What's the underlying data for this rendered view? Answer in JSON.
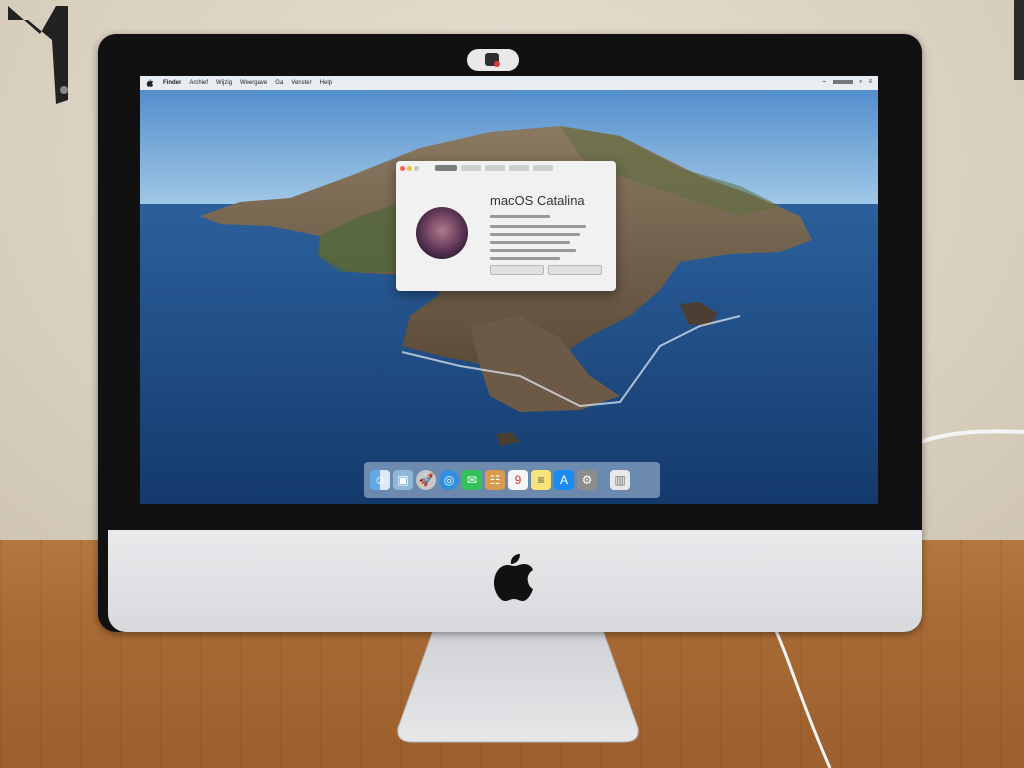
{
  "menubar": {
    "items": [
      "Finder",
      "Archief",
      "Wijzig",
      "Weergave",
      "Ga",
      "Venster",
      "Help"
    ]
  },
  "about_window": {
    "title": "macOS Catalina"
  },
  "dock": {
    "icons": [
      "finder-icon",
      "preview-icon",
      "launchpad-icon",
      "safari-icon",
      "messages-icon",
      "contacts-icon",
      "calendar-icon",
      "notes-icon",
      "app-store-icon",
      "system-preferences-icon",
      "trash-icon"
    ]
  },
  "colors": {
    "sky": "#7fb2e0",
    "sea": "#1b4a82",
    "menubar": "#f5f5f5",
    "bezel": "#111111",
    "chin": "#e1e3e5"
  }
}
